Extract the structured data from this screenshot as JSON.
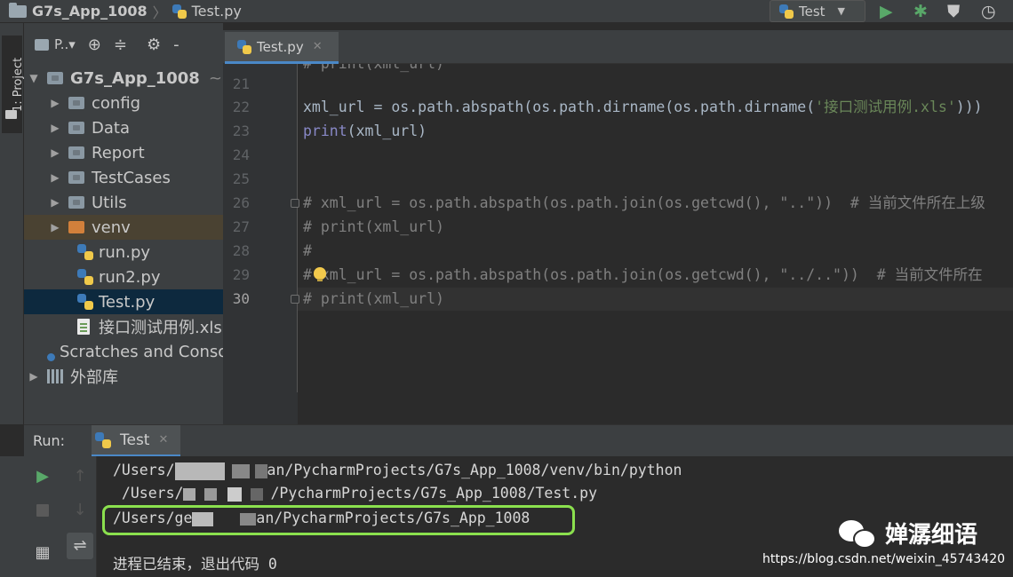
{
  "navbar": {
    "project": "G7s_App_1008",
    "file": "Test.py",
    "run_config": "Test"
  },
  "leftstrip": {
    "tab": "1: Project"
  },
  "project_panel": {
    "label": "P..▾",
    "root": "G7s_App_1008",
    "root_suffix": "~",
    "items": [
      {
        "label": "config",
        "type": "folder"
      },
      {
        "label": "Data",
        "type": "folder"
      },
      {
        "label": "Report",
        "type": "folder"
      },
      {
        "label": "TestCases",
        "type": "folder"
      },
      {
        "label": "Utils",
        "type": "folder"
      },
      {
        "label": "venv",
        "type": "folder-excluded"
      },
      {
        "label": "run.py",
        "type": "python"
      },
      {
        "label": "run2.py",
        "type": "python"
      },
      {
        "label": "Test.py",
        "type": "python",
        "selected": true
      },
      {
        "label": "接口测试用例.xls",
        "type": "spreadsheet"
      },
      {
        "label": "Scratches and Consoles",
        "type": "scratches"
      },
      {
        "label": "外部库",
        "type": "libraries"
      }
    ]
  },
  "editor": {
    "tab": "Test.py",
    "line_numbers": [
      "21",
      "22",
      "23",
      "24",
      "25",
      "26",
      "27",
      "28",
      "29",
      "30"
    ],
    "current_line": "30",
    "lines": {
      "l20": "# print(xml_url)",
      "l22_a": "xml_url = os.path.abspath(os.path.dirname(os.path.dirname(",
      "l22_str": "'接口测试用例.xls'",
      "l22_b": ")))",
      "l23_kw": "print",
      "l23_b": "(xml_url)",
      "l26": "# xml_url = os.path.abspath(os.path.join(os.getcwd(), \"..\"))  # 当前文件所在上级",
      "l27": "# print(xml_url)",
      "l28": "#",
      "l29": "# xml_url = os.path.abspath(os.path.join(os.getcwd(), \"../..\"))  # 当前文件所在",
      "l30": "# print(xml_url)"
    }
  },
  "run_panel": {
    "label": "Run:",
    "tab": "Test",
    "output": {
      "line1_a": "/Users/",
      "line1_b": "an/PycharmProjects/G7s_App_1008/venv/bin/python",
      "line2_a": " /Users/",
      "line2_b": "/PycharmProjects/G7s_App_1008/Test.py",
      "line3_a": "/Users/ge",
      "line3_b": "an/PycharmProjects/G7s_App_1008",
      "line4": "进程已结束，退出代码 0"
    }
  },
  "watermark": {
    "brand": "婵潺细语",
    "url": "https://blog.csdn.net/weixin_45743420"
  }
}
